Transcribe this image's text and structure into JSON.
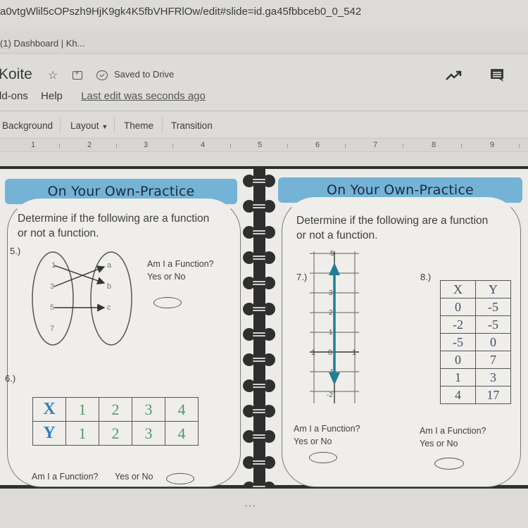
{
  "browser": {
    "url": "a0vtgWlil5cOPszh9HjK9gk4K5fbVHFRlOw/edit#slide=id.ga45fbbceb0_0_542",
    "bookmark": "(1) Dashboard | Kh..."
  },
  "doc": {
    "title": "Koite",
    "saved_status": "Saved to Drive",
    "icons": [
      "star-icon",
      "move-to-folder-icon",
      "cloud-saved-icon",
      "activity-trend-icon",
      "comment-icon"
    ],
    "menu": [
      "dd-ons",
      "Help"
    ],
    "last_edit": "Last edit was seconds ago"
  },
  "toolbar": {
    "background": "Background",
    "layout": "Layout",
    "theme": "Theme",
    "transition": "Transition"
  },
  "ruler": [
    "1",
    "2",
    "3",
    "4",
    "5",
    "6",
    "7",
    "8",
    "9"
  ],
  "slide": {
    "colors": {
      "banner": "#74b3d6",
      "spine": "#2e2e2e",
      "table_header": "#2f7fc4",
      "table_value": "#4f9a6a",
      "graph_line": "#1f7f96"
    },
    "left": {
      "banner": "On Your Own-Practice",
      "instructions_line1": "Determine if the following are a function",
      "instructions_line2": "or not a function.",
      "q5": {
        "number": "5.)",
        "domain": [
          "1",
          "3",
          "5",
          "7"
        ],
        "range": [
          "a",
          "b",
          "c"
        ],
        "mappings": [
          [
            "1",
            "b"
          ],
          [
            "3",
            "a"
          ],
          [
            "5",
            "c"
          ]
        ],
        "prompt1": "Am I a Function?",
        "prompt2": "Yes or No"
      },
      "q6": {
        "number": "6.)",
        "x_label": "X",
        "y_label": "Y",
        "x": [
          "1",
          "2",
          "3",
          "4"
        ],
        "y": [
          "1",
          "2",
          "3",
          "4"
        ],
        "prompt1": "Am I a Function?",
        "prompt2": "Yes or No"
      }
    },
    "right": {
      "banner": "On Your Own-Practice",
      "instructions_line1": "Determine if the following are a function",
      "instructions_line2": "or not a function.",
      "q7": {
        "number": "7.)",
        "y_ticks": [
          "5",
          "3",
          "2",
          "1",
          "0",
          "-1",
          "-2"
        ],
        "x_ticks": [
          "1",
          "0",
          "1"
        ],
        "line": "vertical line at x = 0 with arrows at both ends",
        "prompt1": "Am I a Function?",
        "prompt2": "Yes or No"
      },
      "q8": {
        "number": "8.)",
        "headers": [
          "X",
          "Y"
        ],
        "rows": [
          [
            "0",
            "-5"
          ],
          [
            "-2",
            "-5"
          ],
          [
            "-5",
            "0"
          ],
          [
            "0",
            "7"
          ],
          [
            "1",
            "3"
          ],
          [
            "4",
            "17"
          ]
        ],
        "prompt1": "Am I a Function?",
        "prompt2": "Yes or No"
      }
    }
  }
}
